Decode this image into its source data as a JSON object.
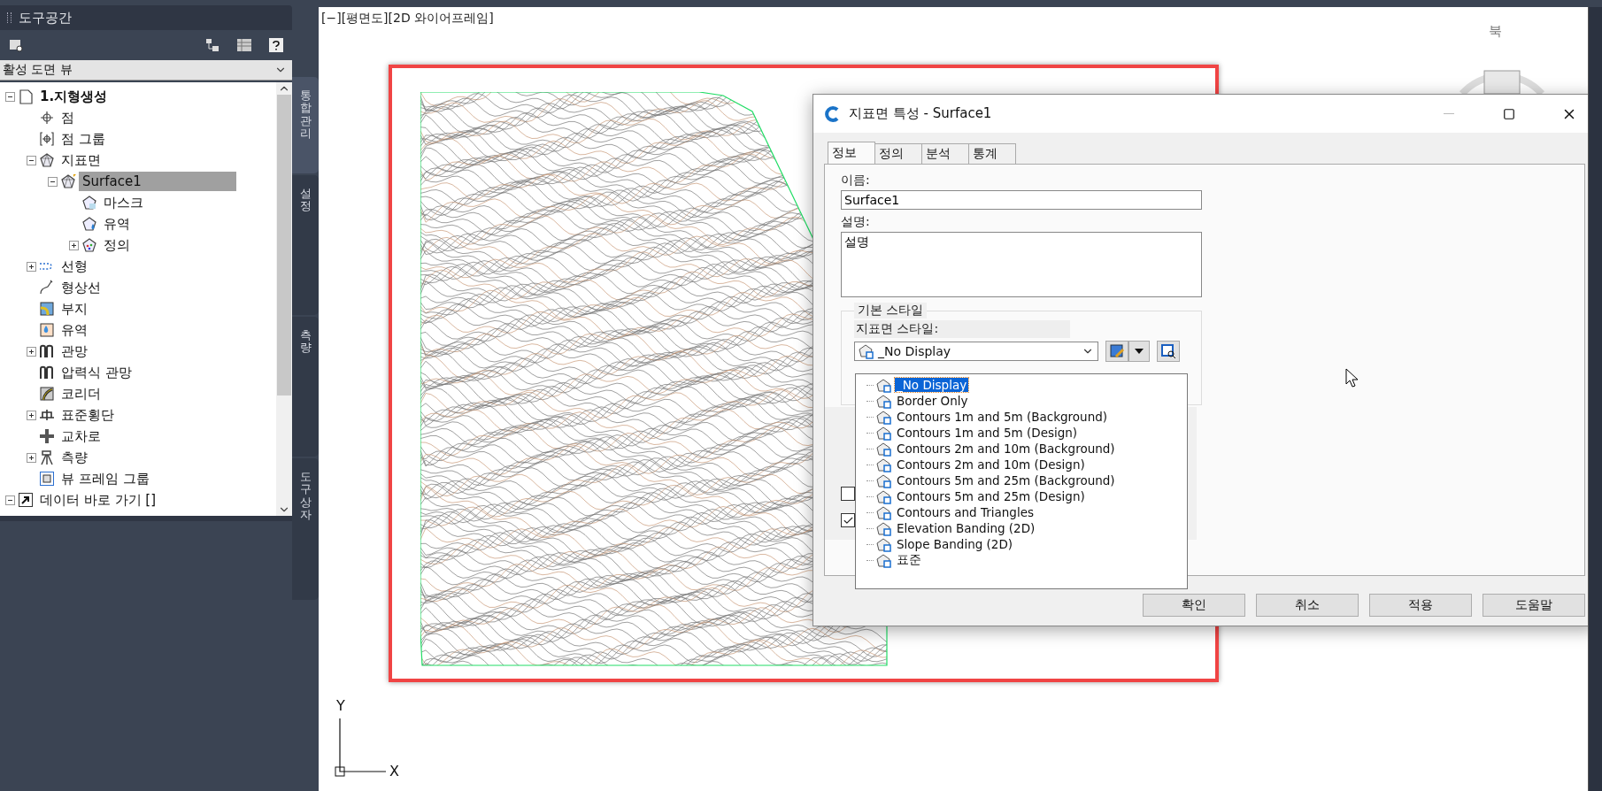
{
  "toolspace": {
    "title": "도구공간",
    "view_selector": "활성 도면 뷰",
    "tree": [
      {
        "label": "1.지형생성",
        "kind": "document",
        "selected": false,
        "expanded": true,
        "children": [
          {
            "label": "점",
            "kind": "point",
            "selected": false
          },
          {
            "label": "점 그룹",
            "kind": "point-group",
            "selected": false
          },
          {
            "label": "지표면",
            "kind": "surface",
            "selected": false,
            "expanded": true,
            "children": [
              {
                "label": "Surface1",
                "kind": "surface-flagged",
                "selected": true,
                "expanded": true,
                "children": [
                  {
                    "label": "마스크",
                    "kind": "mask",
                    "selected": false
                  },
                  {
                    "label": "유역",
                    "kind": "watershed",
                    "selected": false
                  },
                  {
                    "label": "정의",
                    "kind": "definition",
                    "selected": false,
                    "expanded": false
                  }
                ]
              }
            ]
          },
          {
            "label": "선형",
            "kind": "alignment",
            "selected": false,
            "expanded": false
          },
          {
            "label": "형상선",
            "kind": "feature-line",
            "selected": false
          },
          {
            "label": "부지",
            "kind": "site",
            "selected": false
          },
          {
            "label": "유역",
            "kind": "catchment",
            "selected": false
          },
          {
            "label": "관망",
            "kind": "pipe",
            "selected": false,
            "expanded": false
          },
          {
            "label": "압력식 관망",
            "kind": "pipe",
            "selected": false
          },
          {
            "label": "코리더",
            "kind": "corridor",
            "selected": false
          },
          {
            "label": "표준횡단",
            "kind": "assembly",
            "selected": false,
            "expanded": false
          },
          {
            "label": "교차로",
            "kind": "intersection",
            "selected": false
          },
          {
            "label": "측량",
            "kind": "survey",
            "selected": false,
            "expanded": false
          },
          {
            "label": "뷰 프레임 그룹",
            "kind": "view-frame",
            "selected": false
          }
        ]
      },
      {
        "label": "데이터 바로 가기 []",
        "kind": "shortcut",
        "selected": false,
        "expanded": true
      }
    ],
    "side_tabs": [
      {
        "label": "통합관리",
        "selected": true
      },
      {
        "label": "설정",
        "selected": false
      },
      {
        "label": "측량",
        "selected": false
      },
      {
        "label": "도구 상자",
        "selected": false
      }
    ]
  },
  "viewport": {
    "label": "[−][평면도][2D 와이어프레임]",
    "compass": "북",
    "ucs": {
      "x": "X",
      "y": "Y"
    }
  },
  "dialog": {
    "title": "지표면 특성 - Surface1",
    "tabs": [
      {
        "label": "정보",
        "selected": true
      },
      {
        "label": "정의",
        "selected": false
      },
      {
        "label": "분석",
        "selected": false
      },
      {
        "label": "통계",
        "selected": false
      }
    ],
    "name_label": "이름:",
    "name_value": "Surface1",
    "description_label": "설명:",
    "description_value": "설명",
    "group_title": "기본 스타일",
    "style_label": "지표면 스타일:",
    "style_value": "_No Display",
    "style_options": [
      {
        "label": "_No Display",
        "selected": true
      },
      {
        "label": "Border Only",
        "selected": false
      },
      {
        "label": "Contours 1m and 5m (Background)",
        "selected": false
      },
      {
        "label": "Contours 1m and 5m (Design)",
        "selected": false
      },
      {
        "label": "Contours 2m and 10m (Background)",
        "selected": false
      },
      {
        "label": "Contours 2m and 10m (Design)",
        "selected": false
      },
      {
        "label": "Contours 5m and 25m (Background)",
        "selected": false
      },
      {
        "label": "Contours 5m and 25m (Design)",
        "selected": false
      },
      {
        "label": "Contours and Triangles",
        "selected": false
      },
      {
        "label": "Elevation Banding (2D)",
        "selected": false
      },
      {
        "label": "Slope Banding (2D)",
        "selected": false
      },
      {
        "label": "표준",
        "selected": false
      }
    ],
    "checkboxes": [
      {
        "checked": false
      },
      {
        "checked": true
      }
    ],
    "buttons": [
      "확인",
      "취소",
      "적용",
      "도움말"
    ]
  }
}
